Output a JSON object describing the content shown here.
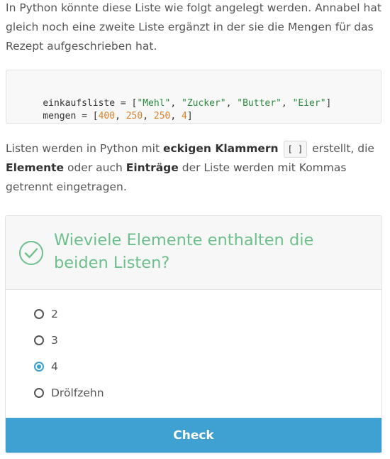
{
  "intro_text": "In Python könnte diese Liste wie folgt angelegt werden. Annabel hat gleich noch eine zweite Liste ergänzt in der sie die Mengen für das Rezept aufgeschrieben hat.",
  "code": {
    "line1": {
      "prefix": "einkaufsliste = [",
      "items": [
        "\"Mehl\"",
        "\"Zucker\"",
        "\"Butter\"",
        "\"Eier\""
      ],
      "separator": ", ",
      "suffix": "]"
    },
    "line2": {
      "prefix": "mengen = [",
      "items": [
        "400",
        "250",
        "250",
        "4"
      ],
      "separator": ", ",
      "suffix": "]"
    },
    "string_color": "#2b8a3e",
    "number_color": "#d9822b"
  },
  "explain": {
    "t1": "Listen werden in Python mit ",
    "b1": "eckigen Klammern",
    "code": "[ ]",
    "t2": " erstellt, die ",
    "b2": "Elemente",
    "t3": " oder auch ",
    "b3": "Einträge",
    "t4": " der Liste werden mit Kommas getrennt eingetragen."
  },
  "quiz": {
    "question": "Wieviele Elemente enthalten die beiden Listen?",
    "options": [
      {
        "label": "2",
        "selected": false
      },
      {
        "label": "3",
        "selected": false
      },
      {
        "label": "4",
        "selected": true
      },
      {
        "label": "Drölfzehn",
        "selected": false
      }
    ],
    "check_label": "Check",
    "accent_color": "#6cc08b",
    "button_color": "#3ea1d1"
  }
}
